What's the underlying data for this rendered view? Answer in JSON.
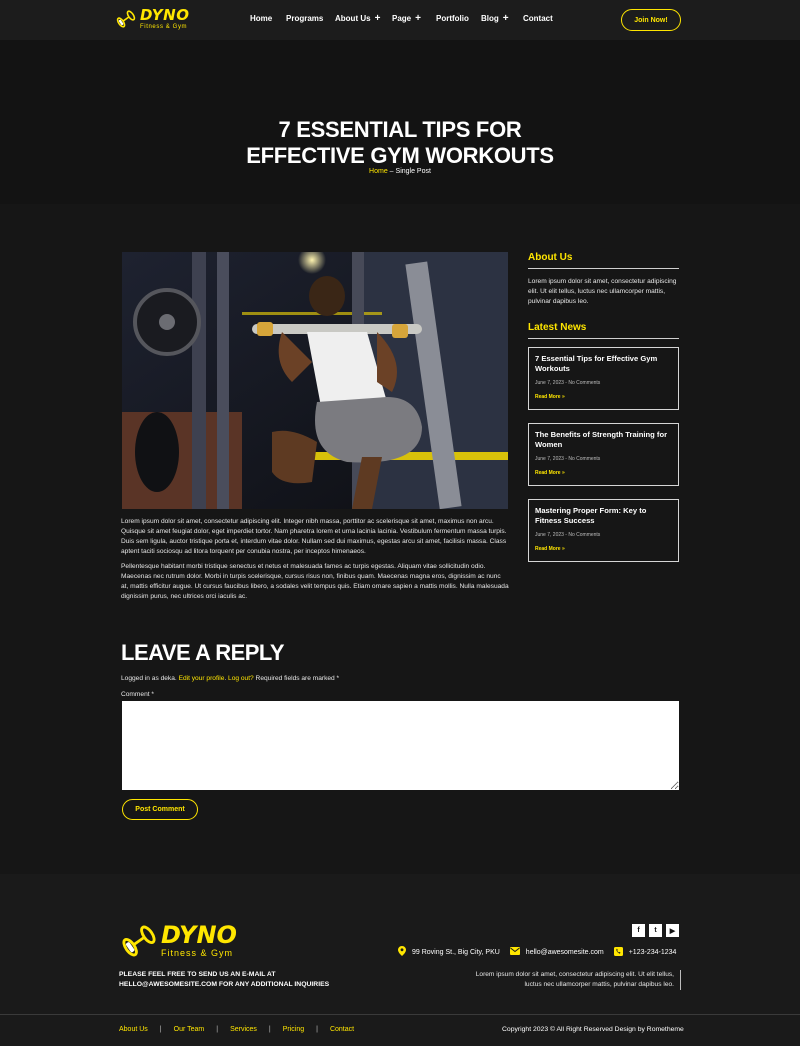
{
  "header": {
    "logo_title": "DYNO",
    "logo_sub": "Fitness & Gym",
    "nav": [
      {
        "label": "Home",
        "plus": false
      },
      {
        "label": "Programs",
        "plus": false
      },
      {
        "label": "About Us",
        "plus": true
      },
      {
        "label": "Page",
        "plus": true
      },
      {
        "label": "Portfolio",
        "plus": false
      },
      {
        "label": "Blog",
        "plus": true
      },
      {
        "label": "Contact",
        "plus": false
      }
    ],
    "join_label": "Join Now!"
  },
  "hero": {
    "title_line1": "7 ESSENTIAL TIPS FOR",
    "title_line2": "EFFECTIVE GYM WORKOUTS",
    "crumb_home": "Home",
    "crumb_sep": " – ",
    "crumb_current": "Single Post"
  },
  "post": {
    "paragraph1": "Lorem ipsum dolor sit amet, consectetur adipiscing elit. Integer nibh massa, porttitor ac scelerisque sit amet, maximus non arcu. Quisque sit amet feugiat dolor, eget imperdiet tortor. Nam pharetra lorem et urna lacinia lacinia. Vestibulum fermentum massa turpis. Duis sem ligula, auctor tristique porta et, interdum vitae dolor. Nullam sed dui maximus, egestas arcu sit amet, facilisis massa. Class aptent taciti sociosqu ad litora torquent per conubia nostra, per inceptos himenaeos.",
    "paragraph2": "Pellentesque habitant morbi tristique senectus et netus et malesuada fames ac turpis egestas. Aliquam vitae sollicitudin odio. Maecenas nec rutrum dolor. Morbi in turpis scelerisque, cursus risus non, finibus quam. Maecenas magna eros, dignissim ac nunc at, mattis efficitur augue. Ut cursus faucibus libero, a sodales velit tempus quis. Etiam ornare sapien a mattis mollis. Nulla malesuada dignissim purus, nec ultrices orci iaculis ac."
  },
  "sidebar": {
    "about_title": "About Us",
    "about_text": "Lorem ipsum dolor sit amet, consectetur adipiscing elit. Ut elit tellus, luctus nec ullamcorper mattis, pulvinar dapibus leo.",
    "news_title": "Latest News",
    "news": [
      {
        "title": "7 Essential Tips for Effective Gym Workouts",
        "meta": "June 7, 2023 - No Comments",
        "more": "Read More »"
      },
      {
        "title": "The Benefits of Strength Training for Women",
        "meta": "June 7, 2023 - No Comments",
        "more": "Read More »"
      },
      {
        "title": "Mastering Proper Form: Key to Fitness Success",
        "meta": "June 7, 2023 - No Comments",
        "more": "Read More »"
      }
    ]
  },
  "reply": {
    "title": "LEAVE A REPLY",
    "logged_prefix": "Logged in as deka. ",
    "edit_profile": "Edit your profile",
    "logout": "Log out?",
    "required": " Required fields are marked *",
    "comment_label": "Comment *",
    "comment_value": "",
    "submit_label": "Post Comment"
  },
  "footer": {
    "logo_title": "DYNO",
    "logo_sub": "Fitness & Gym",
    "note_line1": "PLEASE FEEL FREE TO SEND US AN E-MAIL AT",
    "note_line2": "HELLO@AWESOMESITE.COM FOR ANY ADDITIONAL INQUIRIES",
    "socials": [
      "f",
      "t",
      "▶"
    ],
    "address": "99 Roving St., Big City, PKU",
    "email": "hello@awesomesite.com",
    "phone": "+123-234-1234",
    "description": "Lorem ipsum dolor sit amet, consectetur adipiscing elit. Ut elit tellus, luctus nec ullamcorper mattis, pulvinar dapibus leo.",
    "links": [
      "About Us",
      "Our Team",
      "Services",
      "Pricing",
      "Contact"
    ],
    "copyright": "Copyright 2023 © All Right Reserved Design by Rometheme"
  },
  "colors": {
    "accent": "#ffe600",
    "background": "#161616"
  }
}
